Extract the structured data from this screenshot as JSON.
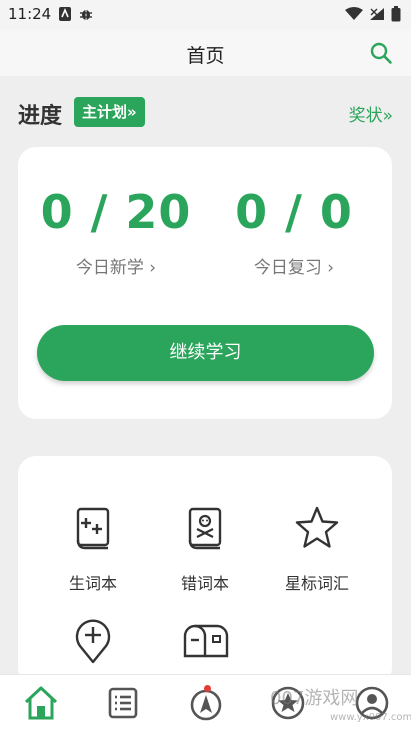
{
  "status_bar": {
    "time": "11:24"
  },
  "header": {
    "title": "首页"
  },
  "progress": {
    "title": "进度",
    "plan_badge": "主计划»",
    "reward_link": "奖状»"
  },
  "stats": [
    {
      "value": "0 / 20",
      "label": "今日新学 ›"
    },
    {
      "value": "0 / 0",
      "label": "今日复习 ›"
    }
  ],
  "continue_button": "继续学习",
  "tools": [
    {
      "label": "生词本",
      "icon": "new-words-book-icon"
    },
    {
      "label": "错词本",
      "icon": "wrong-words-book-icon"
    },
    {
      "label": "星标词汇",
      "icon": "star-icon"
    },
    {
      "label": "",
      "icon": "add-location-icon"
    },
    {
      "label": "",
      "icon": "mailbox-icon"
    }
  ],
  "tabbar": {
    "tabs": [
      "home-icon",
      "list-icon",
      "compass-icon",
      "star-badge-icon",
      "profile-icon"
    ]
  },
  "watermark": {
    "text": "007游戏网",
    "url": "www.yx007.com"
  },
  "colors": {
    "accent": "#2aa55b",
    "background": "#eeeeee",
    "card": "#ffffff"
  }
}
